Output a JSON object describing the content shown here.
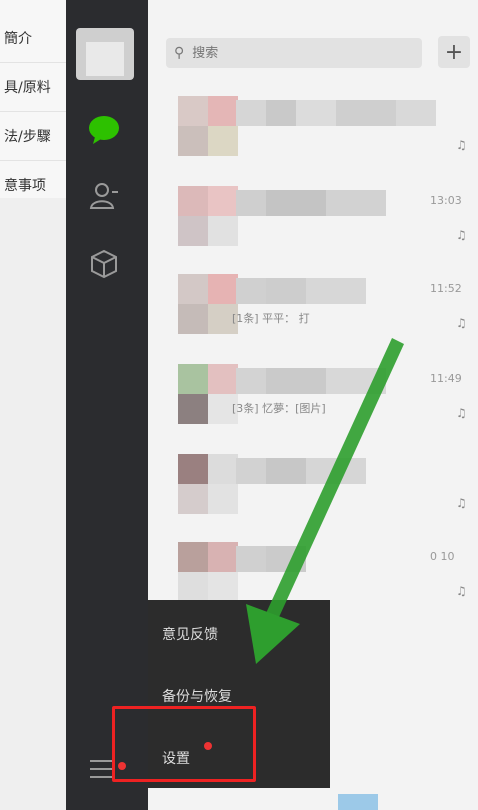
{
  "left_panel": {
    "items": [
      "簡介",
      "具/原料",
      "法/步驟",
      "意事项"
    ]
  },
  "sidebar": {
    "chat_color": "#2dc100"
  },
  "search": {
    "placeholder": "搜索"
  },
  "chats": [
    {
      "preview": "",
      "time": ""
    },
    {
      "preview": "",
      "time": "13:03"
    },
    {
      "preview": "[1条] 平平：    打",
      "time": "11:52"
    },
    {
      "preview": "[3条] 忆夢：[图片]",
      "time": "11:49"
    },
    {
      "preview": "",
      "time": ""
    },
    {
      "preview": "",
      "time": "0 10"
    }
  ],
  "popup": {
    "feedback": "意见反馈",
    "backup": "备份与恢复",
    "settings": "设置"
  },
  "colors": {
    "highlight": "#e22222",
    "arrow": "#2e9e2e"
  }
}
